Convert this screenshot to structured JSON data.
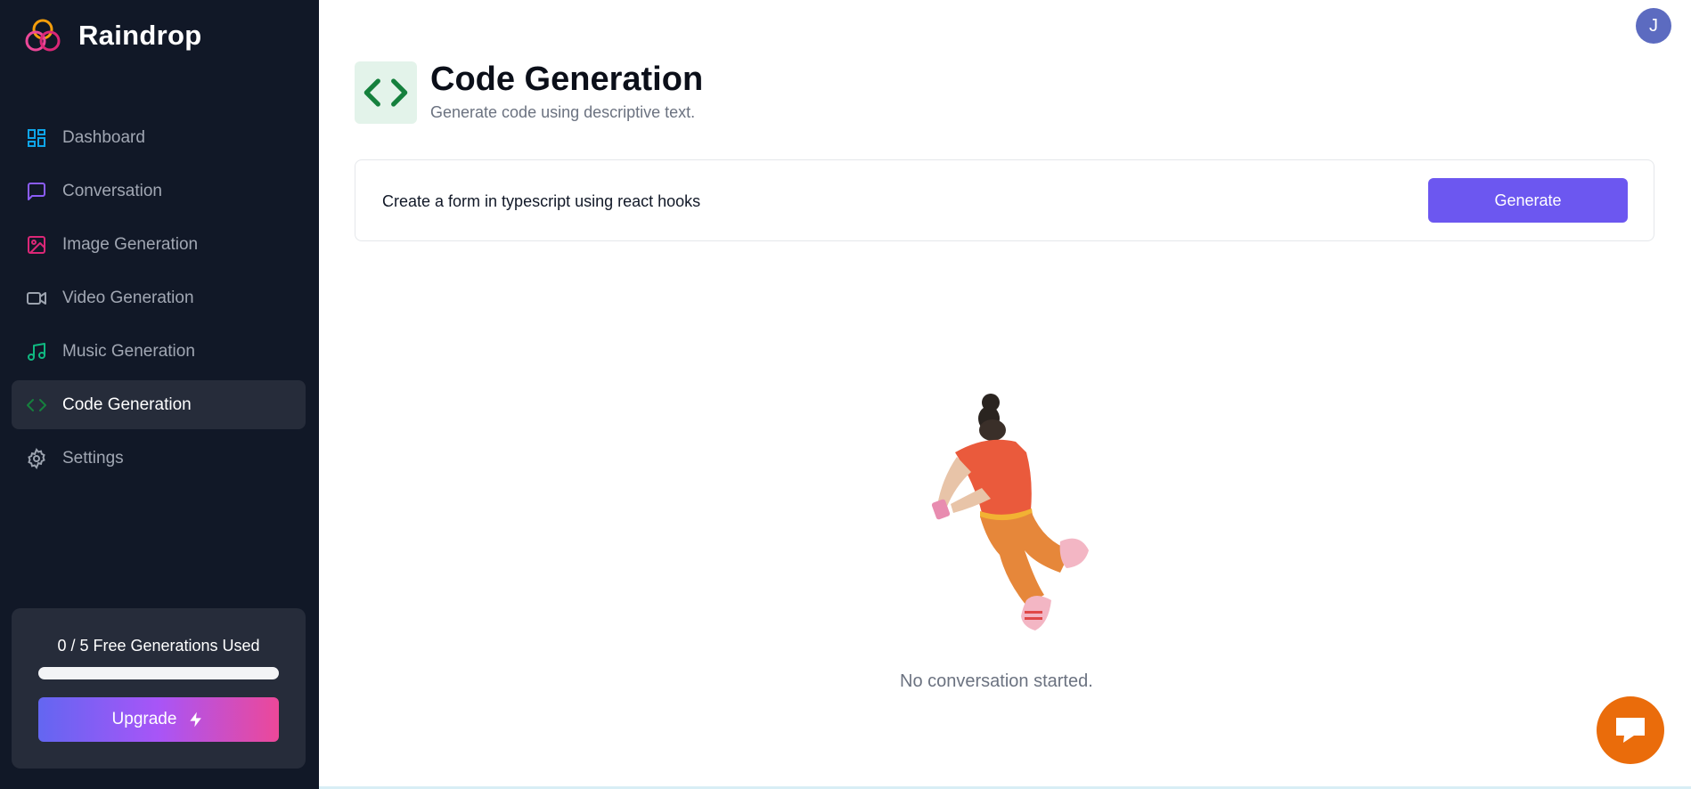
{
  "app": {
    "name": "Raindrop"
  },
  "sidebar": {
    "items": [
      {
        "label": "Dashboard",
        "icon": "dashboard-icon",
        "color": "#0ea5e9",
        "active": false
      },
      {
        "label": "Conversation",
        "icon": "message-square-icon",
        "color": "#8b5cf6",
        "active": false
      },
      {
        "label": "Image Generation",
        "icon": "image-icon",
        "color": "#db2777",
        "active": false
      },
      {
        "label": "Video Generation",
        "icon": "video-icon",
        "color": "#9ca3af",
        "active": false
      },
      {
        "label": "Music Generation",
        "icon": "music-icon",
        "color": "#10b981",
        "active": false
      },
      {
        "label": "Code Generation",
        "icon": "code-icon",
        "color": "#15803d",
        "active": true
      },
      {
        "label": "Settings",
        "icon": "settings-icon",
        "color": "#9ca3af",
        "active": false
      }
    ],
    "usage": {
      "text": "0 / 5 Free Generations Used",
      "used": 0,
      "limit": 5
    },
    "upgrade_label": "Upgrade"
  },
  "user": {
    "avatar_initial": "J"
  },
  "header": {
    "title": "Code Generation",
    "subtitle": "Generate code using descriptive text.",
    "icon": "code-icon",
    "icon_color": "#15803d"
  },
  "prompt": {
    "value": "Create a form in typescript using react hooks",
    "button_label": "Generate"
  },
  "empty_state": {
    "text": "No conversation started."
  },
  "colors": {
    "sidebar_bg": "#111827",
    "accent": "#6c57f0",
    "chat_button": "#ea6c0b"
  }
}
